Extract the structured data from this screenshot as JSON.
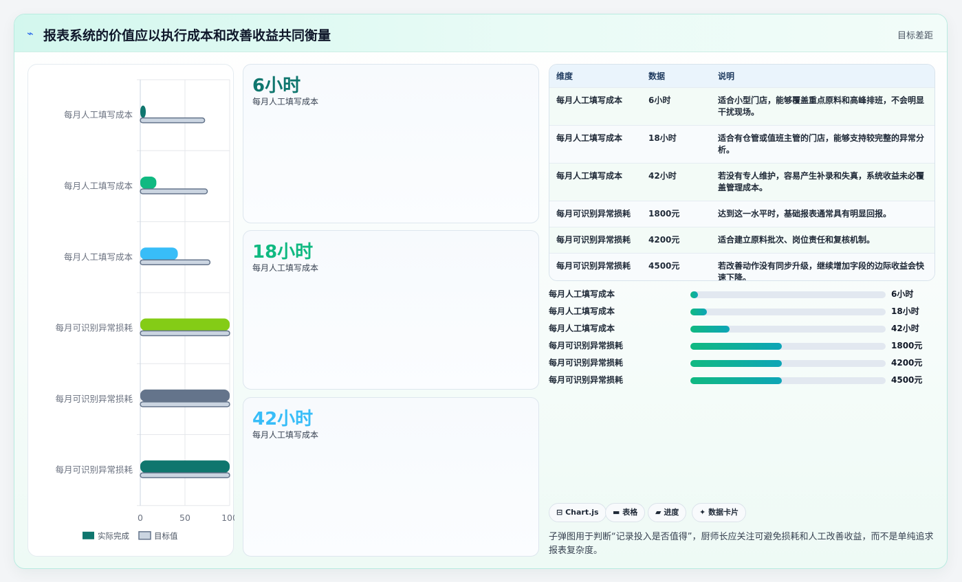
{
  "header": {
    "icon": "bolt-icon",
    "title": "报表系统的价值应以执行成本和改善收益共同衡量",
    "right_link": "目标差距"
  },
  "chart_data": {
    "type": "bar",
    "orientation": "horizontal",
    "categories": [
      "每月人工填写成本",
      "每月人工填写成本",
      "每月人工填写成本",
      "每月可识别异常损耗",
      "每月可识别异常损耗",
      "每月可识别异常损耗"
    ],
    "series": [
      {
        "name": "实际完成",
        "values": [
          6,
          18,
          42,
          100,
          100,
          100
        ],
        "colors": [
          "#0f766e",
          "#10b981",
          "#38bdf8",
          "#84cc16",
          "#64748b",
          "#0f766e"
        ]
      },
      {
        "name": "目标值",
        "values": [
          72,
          75,
          78,
          100,
          100,
          100
        ],
        "colors": [
          "#cbd5e1",
          "#cbd5e1",
          "#cbd5e1",
          "#cbd5e1",
          "#cbd5e1",
          "#cbd5e1"
        ]
      }
    ],
    "xlim": [
      0,
      100
    ],
    "xticks": [
      "0",
      "50",
      "100"
    ],
    "grid": true,
    "legend": "bottom"
  },
  "kpis": [
    {
      "value": "6小时",
      "label": "每月人工填写成本",
      "color": "#0f766e"
    },
    {
      "value": "18小时",
      "label": "每月人工填写成本",
      "color": "#10b981"
    },
    {
      "value": "42小时",
      "label": "每月人工填写成本",
      "color": "#38bdf8"
    }
  ],
  "table": {
    "headers": [
      "维度",
      "数据",
      "说明"
    ],
    "rows": [
      [
        "每月人工填写成本",
        "6小时",
        "适合小型门店，能够覆盖重点原料和高峰排班，不会明显干扰现场。"
      ],
      [
        "每月人工填写成本",
        "18小时",
        "适合有仓管或值班主管的门店，能够支持较完整的异常分析。"
      ],
      [
        "每月人工填写成本",
        "42小时",
        "若没有专人维护，容易产生补录和失真，系统收益未必覆盖管理成本。"
      ],
      [
        "每月可识别异常损耗",
        "1800元",
        "达到这一水平时，基础报表通常具有明显回报。"
      ],
      [
        "每月可识别异常损耗",
        "4200元",
        "适合建立原料批次、岗位责任和复核机制。"
      ],
      [
        "每月可识别异常损耗",
        "4500元",
        "若改善动作没有同步升级，继续增加字段的边际收益会快速下降。"
      ]
    ]
  },
  "progress": [
    {
      "label": "每月人工填写成本",
      "value": "6小时",
      "fraction": 0.04
    },
    {
      "label": "每月人工填写成本",
      "value": "18小时",
      "fraction": 0.085
    },
    {
      "label": "每月人工填写成本",
      "value": "42小时",
      "fraction": 0.2
    },
    {
      "label": "每月可识别异常损耗",
      "value": "1800元",
      "fraction": 0.47
    },
    {
      "label": "每月可识别异常损耗",
      "value": "4200元",
      "fraction": 0.47
    },
    {
      "label": "每月可识别异常损耗",
      "value": "4500元",
      "fraction": 0.47
    }
  ],
  "tags": [
    {
      "icon": "chart-icon",
      "glyph": "⊟",
      "label": "Chart.js"
    },
    {
      "icon": "table-icon",
      "glyph": "▬",
      "label": "表格"
    },
    {
      "icon": "progress-icon",
      "glyph": "▰",
      "label": "进度"
    },
    {
      "icon": "sparkle-icon",
      "glyph": "✦",
      "label": "数据卡片"
    }
  ],
  "note": "子弹图用于判断“记录投入是否值得”，厨师长应关注可避免损耗和人工改善收益，而不是单纯追求报表复杂度。"
}
